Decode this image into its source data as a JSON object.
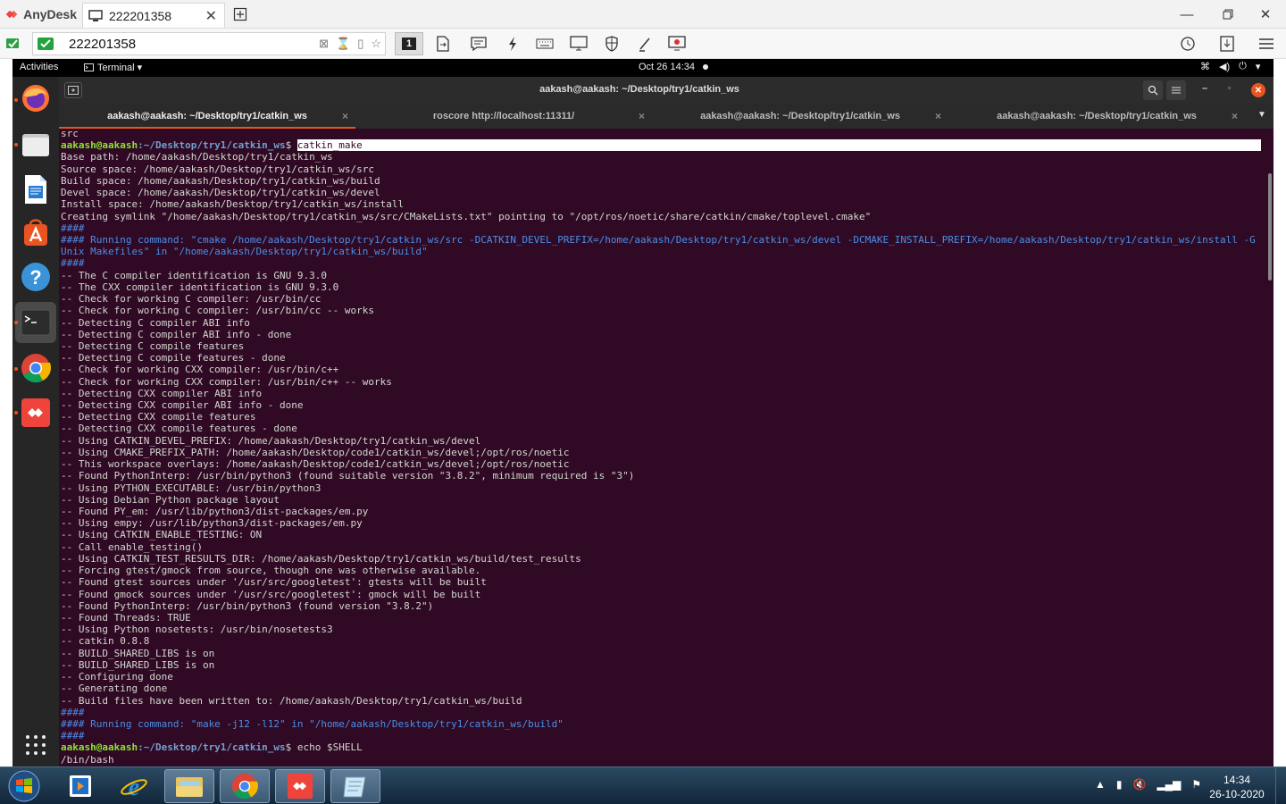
{
  "anydesk": {
    "app_name": "AnyDesk",
    "tab_label": "222201358",
    "address_value": "222201358",
    "display_number": "1",
    "brand_color": "#ef443b"
  },
  "ubuntu_topbar": {
    "activities": "Activities",
    "app_menu": "Terminal ▾",
    "clock": "Oct 26  14:34"
  },
  "terminal": {
    "title": "aakash@aakash: ~/Desktop/try1/catkin_ws",
    "tabs": [
      {
        "label": "aakash@aakash: ~/Desktop/try1/catkin_ws",
        "active": true
      },
      {
        "label": "roscore http://localhost:11311/",
        "active": false
      },
      {
        "label": "aakash@aakash: ~/Desktop/try1/catkin_ws",
        "active": false
      },
      {
        "label": "aakash@aakash: ~/Desktop/try1/catkin_ws",
        "active": false
      }
    ],
    "prompt_user": "aakash@aakash",
    "prompt_path": ":~/Desktop/try1/catkin_ws",
    "lines": [
      "src",
      "PROMPT:catkin_make",
      "Base path: /home/aakash/Desktop/try1/catkin_ws",
      "Source space: /home/aakash/Desktop/try1/catkin_ws/src",
      "Build space: /home/aakash/Desktop/try1/catkin_ws/build",
      "Devel space: /home/aakash/Desktop/try1/catkin_ws/devel",
      "Install space: /home/aakash/Desktop/try1/catkin_ws/install",
      "Creating symlink \"/home/aakash/Desktop/try1/catkin_ws/src/CMakeLists.txt\" pointing to \"/opt/ros/noetic/share/catkin/cmake/toplevel.cmake\"",
      "HL:####",
      "HL:#### Running command: \"cmake /home/aakash/Desktop/try1/catkin_ws/src -DCATKIN_DEVEL_PREFIX=/home/aakash/Desktop/try1/catkin_ws/devel -DCMAKE_INSTALL_PREFIX=/home/aakash/Desktop/try1/catkin_ws/install -G",
      "HL:Unix Makefiles\" in \"/home/aakash/Desktop/try1/catkin_ws/build\"",
      "HL:####",
      "-- The C compiler identification is GNU 9.3.0",
      "-- The CXX compiler identification is GNU 9.3.0",
      "-- Check for working C compiler: /usr/bin/cc",
      "-- Check for working C compiler: /usr/bin/cc -- works",
      "-- Detecting C compiler ABI info",
      "-- Detecting C compiler ABI info - done",
      "-- Detecting C compile features",
      "-- Detecting C compile features - done",
      "-- Check for working CXX compiler: /usr/bin/c++",
      "-- Check for working CXX compiler: /usr/bin/c++ -- works",
      "-- Detecting CXX compiler ABI info",
      "-- Detecting CXX compiler ABI info - done",
      "-- Detecting CXX compile features",
      "-- Detecting CXX compile features - done",
      "-- Using CATKIN_DEVEL_PREFIX: /home/aakash/Desktop/try1/catkin_ws/devel",
      "-- Using CMAKE_PREFIX_PATH: /home/aakash/Desktop/code1/catkin_ws/devel;/opt/ros/noetic",
      "-- This workspace overlays: /home/aakash/Desktop/code1/catkin_ws/devel;/opt/ros/noetic",
      "-- Found PythonInterp: /usr/bin/python3 (found suitable version \"3.8.2\", minimum required is \"3\")",
      "-- Using PYTHON_EXECUTABLE: /usr/bin/python3",
      "-- Using Debian Python package layout",
      "-- Found PY_em: /usr/lib/python3/dist-packages/em.py",
      "-- Using empy: /usr/lib/python3/dist-packages/em.py",
      "-- Using CATKIN_ENABLE_TESTING: ON",
      "-- Call enable_testing()",
      "-- Using CATKIN_TEST_RESULTS_DIR: /home/aakash/Desktop/try1/catkin_ws/build/test_results",
      "-- Forcing gtest/gmock from source, though one was otherwise available.",
      "-- Found gtest sources under '/usr/src/googletest': gtests will be built",
      "-- Found gmock sources under '/usr/src/googletest': gmock will be built",
      "-- Found PythonInterp: /usr/bin/python3 (found version \"3.8.2\")",
      "-- Found Threads: TRUE",
      "-- Using Python nosetests: /usr/bin/nosetests3",
      "-- catkin 0.8.8",
      "-- BUILD_SHARED_LIBS is on",
      "-- BUILD_SHARED_LIBS is on",
      "-- Configuring done",
      "-- Generating done",
      "-- Build files have been written to: /home/aakash/Desktop/try1/catkin_ws/build",
      "HL:####",
      "HL:#### Running command: \"make -j12 -l12\" in \"/home/aakash/Desktop/try1/catkin_ws/build\"",
      "HL:####",
      "PROMPT2:echo $SHELL",
      "/bin/bash"
    ]
  },
  "taskbar": {
    "time": "14:34",
    "date": "26-10-2020"
  }
}
